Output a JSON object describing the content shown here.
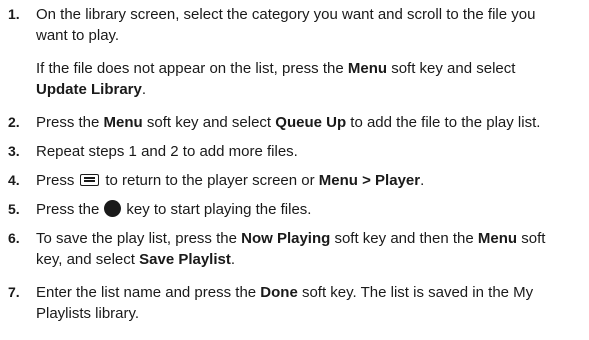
{
  "steps": [
    {
      "number": "1.",
      "lines": [
        "On the library screen, select the category you want and scroll to the file you",
        "want to play."
      ],
      "note": {
        "p1": "If the file does not appear on the list, press the ",
        "b1": "Menu",
        "p2": " soft key and select",
        "b2": "Update Library",
        "p3": "."
      }
    },
    {
      "number": "2.",
      "p1": "Press the ",
      "b1": "Menu",
      "p2": " soft key and select ",
      "b2": "Queue Up",
      "p3": " to add the file to the play list."
    },
    {
      "number": "3.",
      "text": "Repeat steps 1 and 2 to add more files."
    },
    {
      "number": "4.",
      "p1": "Press",
      "icon": "menu-back-key-icon",
      "p2": "to return to the player screen or ",
      "b1": "Menu > Player",
      "p3": "."
    },
    {
      "number": "5.",
      "p1": "Press the",
      "icon": "play-key-icon",
      "p2": "key to start playing the files."
    },
    {
      "number": "6.",
      "p1": "To save the play list, press the ",
      "b1": "Now Playing",
      "p2": " soft key and then the ",
      "b2": "Menu",
      "p3": " soft",
      "p4": "key, and select ",
      "b3": "Save Playlist",
      "p5": "."
    },
    {
      "number": "7.",
      "p1": "Enter the list name and press the ",
      "b1": "Done",
      "p2": " soft key. The list is saved in the My",
      "p3": "Playlists library."
    }
  ]
}
